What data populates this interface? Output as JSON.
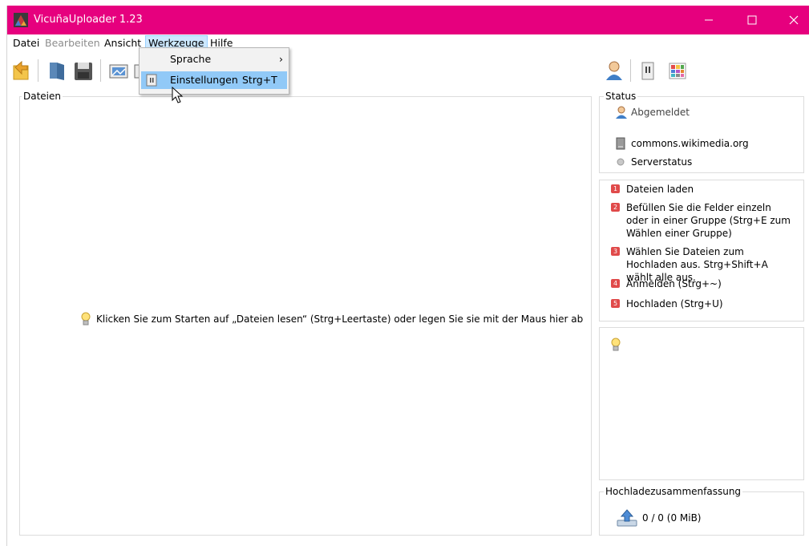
{
  "window": {
    "title": "VicuñaUploader 1.23"
  },
  "menu": {
    "datei": "Datei",
    "bearbeiten": "Bearbeiten",
    "ansicht": "Ansicht",
    "werkzeuge": "Werkzeuge",
    "hilfe": "Hilfe"
  },
  "dropdown": {
    "items": [
      {
        "label": "Sprache",
        "arrow": "›"
      },
      {
        "label": "Einstellungen",
        "shortcut": "Strg+T"
      }
    ]
  },
  "files_panel": {
    "title": "Dateien",
    "hint": "Klicken Sie zum Starten auf „Dateien lesen“ (Strg+Leertaste) oder legen Sie sie mit der Maus hier ab"
  },
  "status": {
    "title": "Status",
    "login": "Abgemeldet",
    "server": "commons.wikimedia.org",
    "serverstatus": "Serverstatus"
  },
  "steps": [
    {
      "n": "1",
      "text": "Dateien laden"
    },
    {
      "n": "2",
      "text": "Befüllen Sie die Felder einzeln oder in einer Gruppe (Strg+E zum Wählen einer Gruppe)"
    },
    {
      "n": "3",
      "text": "Wählen Sie Dateien zum Hochladen aus. Strg+Shift+A wählt alle aus."
    },
    {
      "n": "4",
      "text": "Anmelden (Strg+~)"
    },
    {
      "n": "5",
      "text": "Hochladen (Strg+U)"
    }
  ],
  "upload_summary": {
    "title": "Hochladezusammenfassung",
    "value": "0 / 0 (0 MiB)"
  },
  "colors": {
    "titlebar": "#e6007e",
    "menu_hover": "#91c9f7",
    "step_badge": "#e04a4a"
  }
}
